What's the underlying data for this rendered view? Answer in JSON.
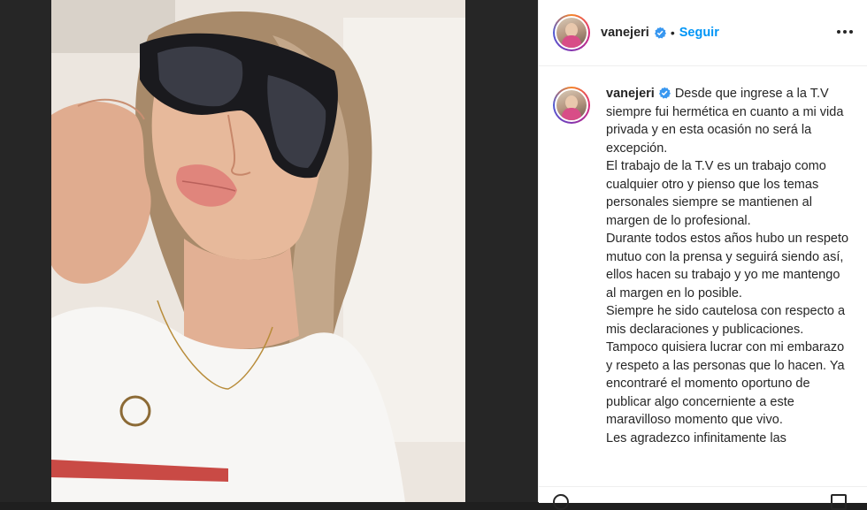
{
  "post": {
    "username": "vanejeri",
    "separator": "•",
    "follow_label": "Seguir",
    "caption": {
      "username": "vanejeri",
      "first_line": "Desde que ingrese a la T.V siempre fui hermética en cuanto a mi vida privada y en esta ocasión no será la excepción.",
      "paragraphs": [
        "El trabajo de la T.V es un trabajo como cualquier otro y pienso que los temas personales siempre se mantienen al margen de lo profesional.",
        "Durante todos estos años hubo un respeto mutuo con la prensa y seguirá siendo así, ellos hacen su trabajo y yo me mantengo al margen en lo posible.",
        "Siempre he sido cautelosa con respecto a mis declaraciones y publicaciones.",
        "Tampoco quisiera lucrar con mi embarazo y respeto a las personas que lo hacen. Ya encontraré el momento oportuno de publicar algo concerniente a este maravilloso momento que vivo.",
        "Les agradezco infinitamente las"
      ]
    }
  },
  "colors": {
    "accent": "#0095f6",
    "text": "#262626",
    "verified": "#3897f0",
    "backdrop": "#1f1f1f"
  },
  "icons": [
    "verified-badge-icon",
    "more-options-icon",
    "story-ring-avatar"
  ]
}
